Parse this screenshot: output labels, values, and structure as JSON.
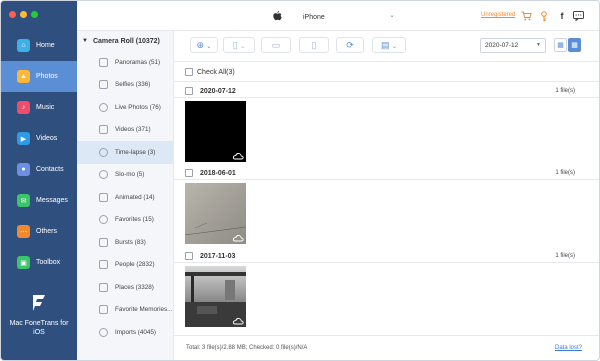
{
  "window": {
    "traffic_lights": {
      "close": "#fc5f57",
      "minimize": "#fdbc2e",
      "zoom": "#28c840"
    }
  },
  "sidebar": {
    "background": "#2f4f7f",
    "active_color": "#5a8fd6",
    "items": [
      {
        "label": "Home",
        "icon": "home-icon",
        "icon_color": "#3db0e6"
      },
      {
        "label": "Photos",
        "icon": "photos-icon",
        "icon_color": "#ffb73a",
        "active": true
      },
      {
        "label": "Music",
        "icon": "music-icon",
        "icon_color": "#ef4e6a"
      },
      {
        "label": "Videos",
        "icon": "videos-icon",
        "icon_color": "#2f9be6"
      },
      {
        "label": "Contacts",
        "icon": "contacts-icon",
        "icon_color": "#6c8fe0"
      },
      {
        "label": "Messages",
        "icon": "messages-icon",
        "icon_color": "#3cc46a"
      },
      {
        "label": "Others",
        "icon": "others-icon",
        "icon_color": "#f08a2f"
      },
      {
        "label": "Toolbox",
        "icon": "toolbox-icon",
        "icon_color": "#3cc46a"
      }
    ],
    "brand": {
      "line1": "Mac FoneTrans for",
      "line2": "iOS",
      "icon": "fonetrans-logo"
    }
  },
  "topbar": {
    "device_name": "iPhone",
    "unregistered": "Unregistered",
    "icons": [
      "cart-icon",
      "key-icon",
      "facebook-icon",
      "chat-icon"
    ]
  },
  "albums": {
    "header": "Camera Roll (10372)",
    "items": [
      {
        "label": "Panoramas (51)",
        "icon": "panorama-icon"
      },
      {
        "label": "Selfies (336)",
        "icon": "selfie-icon"
      },
      {
        "label": "Live Photos (76)",
        "icon": "live-photo-icon"
      },
      {
        "label": "Videos (371)",
        "icon": "video-icon"
      },
      {
        "label": "Time-lapse (3)",
        "icon": "timelapse-icon",
        "active": true
      },
      {
        "label": "Slo-mo (5)",
        "icon": "slomo-icon"
      },
      {
        "label": "Animated (14)",
        "icon": "animated-icon"
      },
      {
        "label": "Favorites (15)",
        "icon": "heart-icon"
      },
      {
        "label": "Bursts (83)",
        "icon": "bursts-icon"
      },
      {
        "label": "People (2832)",
        "icon": "people-icon"
      },
      {
        "label": "Places (3328)",
        "icon": "places-icon"
      },
      {
        "label": "Favorite Memories...",
        "icon": "memories-icon"
      },
      {
        "label": "Imports (4045)",
        "icon": "imports-icon"
      }
    ]
  },
  "toolbar": {
    "date_filter": "2020-07-12",
    "buttons": [
      "add-icon",
      "export-to-device-icon",
      "export-to-pc-icon",
      "phone-icon",
      "sync-icon",
      "toolbox-icon"
    ]
  },
  "content": {
    "check_all": "Check All(3)",
    "groups": [
      {
        "date": "2020-07-12",
        "count": "1 file(s)"
      },
      {
        "date": "2018-06-01",
        "count": "1 file(s)"
      },
      {
        "date": "2017-11-03",
        "count": "1 file(s)"
      }
    ]
  },
  "status": {
    "summary": "Total: 3 file(s)/2.88 MB; Checked: 0 file(s)/N/A",
    "data_lost": "Data lost?"
  }
}
